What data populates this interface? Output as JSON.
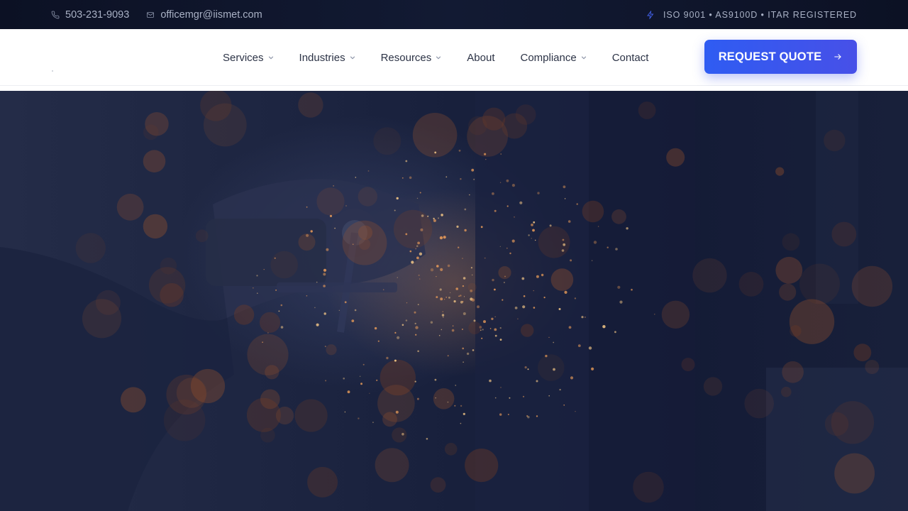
{
  "topbar": {
    "phone": "503-231-9093",
    "email": "officemgr@iismet.com",
    "certifications": "ISO 9001 • AS9100D • ITAR REGISTERED",
    "phone_icon": "phone-icon",
    "email_icon": "mail-icon",
    "cert_icon": "lightning-icon"
  },
  "nav": {
    "items": [
      {
        "label": "Services",
        "has_dropdown": true
      },
      {
        "label": "Industries",
        "has_dropdown": true
      },
      {
        "label": "Resources",
        "has_dropdown": true
      },
      {
        "label": "About",
        "has_dropdown": false
      },
      {
        "label": "Compliance",
        "has_dropdown": true
      },
      {
        "label": "Contact",
        "has_dropdown": false
      }
    ],
    "cta_label": "REQUEST QUOTE",
    "cta_icon": "arrow-right-icon"
  },
  "hero": {
    "image": "grinder-sparks-photo"
  },
  "colors": {
    "accent": "#2f5cf2",
    "topbar_bg": "#0c1124",
    "hero_overlay": "#141b36"
  }
}
